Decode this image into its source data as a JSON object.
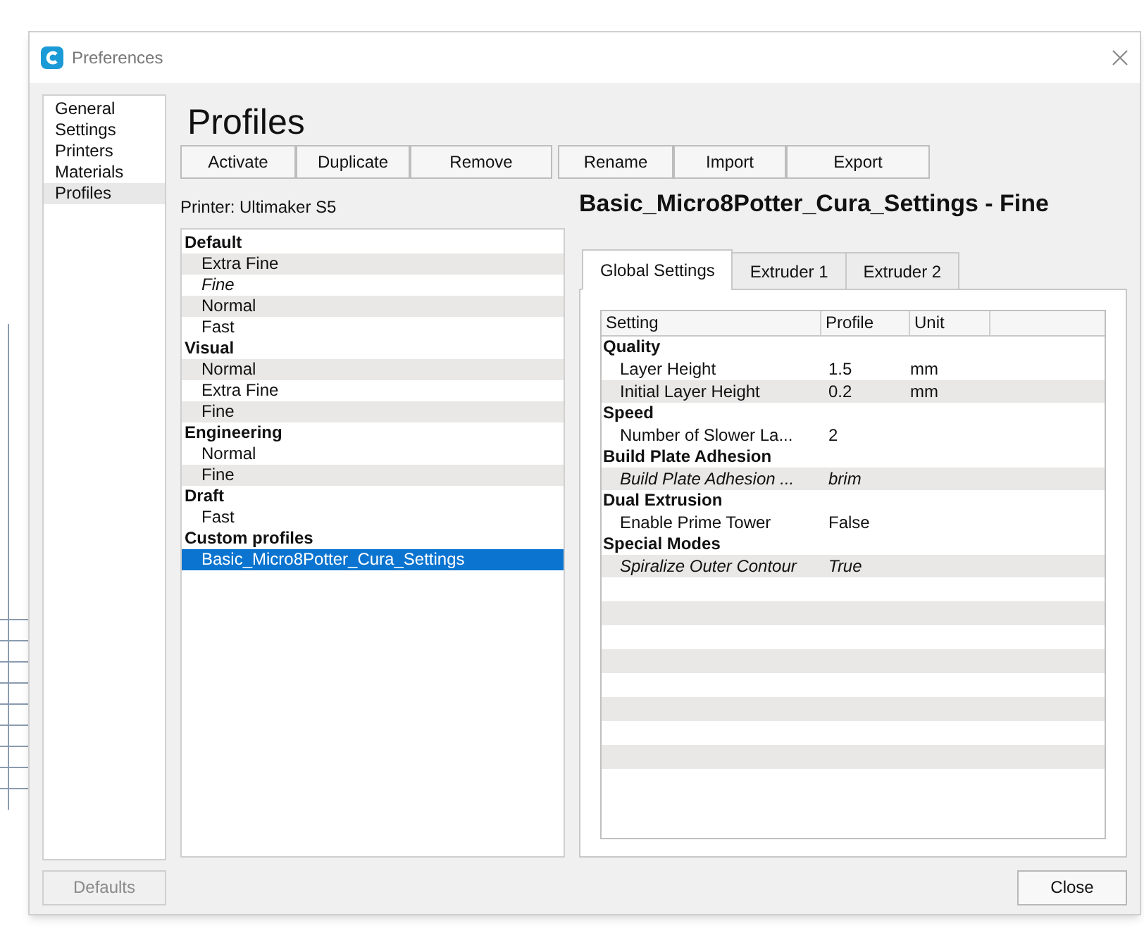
{
  "window": {
    "title": "Preferences"
  },
  "sidebar": {
    "items": [
      {
        "label": "General",
        "selected": false
      },
      {
        "label": "Settings",
        "selected": false
      },
      {
        "label": "Printers",
        "selected": false
      },
      {
        "label": "Materials",
        "selected": false
      },
      {
        "label": "Profiles",
        "selected": true
      }
    ]
  },
  "page": {
    "heading": "Profiles",
    "buttons": [
      "Activate",
      "Duplicate",
      "Remove",
      "Rename",
      "Import",
      "Export"
    ],
    "printer_label": "Printer: Ultimaker S5",
    "profile_groups": [
      {
        "name": "Default",
        "items": [
          {
            "label": "Extra Fine",
            "italic": false,
            "selected": false
          },
          {
            "label": "Fine",
            "italic": true,
            "selected": false
          },
          {
            "label": "Normal",
            "italic": false,
            "selected": false
          },
          {
            "label": "Fast",
            "italic": false,
            "selected": false
          }
        ]
      },
      {
        "name": "Visual",
        "items": [
          {
            "label": "Normal",
            "italic": false,
            "selected": false
          },
          {
            "label": "Extra Fine",
            "italic": false,
            "selected": false
          },
          {
            "label": "Fine",
            "italic": false,
            "selected": false
          }
        ]
      },
      {
        "name": "Engineering",
        "items": [
          {
            "label": "Normal",
            "italic": false,
            "selected": false
          },
          {
            "label": "Fine",
            "italic": false,
            "selected": false
          }
        ]
      },
      {
        "name": "Draft",
        "items": [
          {
            "label": "Fast",
            "italic": false,
            "selected": false
          }
        ]
      },
      {
        "name": "Custom profiles",
        "items": [
          {
            "label": "Basic_Micro8Potter_Cura_Settings",
            "italic": false,
            "selected": true
          }
        ]
      }
    ],
    "profile_title": "Basic_Micro8Potter_Cura_Settings - Fine",
    "tabs": [
      {
        "label": "Global Settings",
        "selected": true
      },
      {
        "label": "Extruder 1",
        "selected": false
      },
      {
        "label": "Extruder 2",
        "selected": false
      }
    ],
    "table": {
      "columns": [
        "Setting",
        "Profile",
        "Unit"
      ],
      "sections": [
        {
          "name": "Quality",
          "rows": [
            {
              "setting": "Layer Height",
              "profile": "1.5",
              "unit": "mm",
              "italic": false
            },
            {
              "setting": "Initial Layer Height",
              "profile": "0.2",
              "unit": "mm",
              "italic": false
            }
          ]
        },
        {
          "name": "Speed",
          "rows": [
            {
              "setting": "Number of Slower La...",
              "profile": "2",
              "italic": false
            }
          ]
        },
        {
          "name": "Build Plate Adhesion",
          "rows": [
            {
              "setting": "Build Plate Adhesion ...",
              "profile": "brim",
              "italic": true
            }
          ]
        },
        {
          "name": "Dual Extrusion",
          "rows": [
            {
              "setting": "Enable Prime Tower",
              "profile": "False",
              "italic": false
            }
          ]
        },
        {
          "name": "Special Modes",
          "rows": [
            {
              "setting": "Spiralize Outer Contour",
              "profile": "True",
              "italic": true
            }
          ]
        }
      ]
    }
  },
  "footer": {
    "defaults_button": {
      "label": "Defaults",
      "disabled": true
    },
    "close_button": "Close"
  }
}
